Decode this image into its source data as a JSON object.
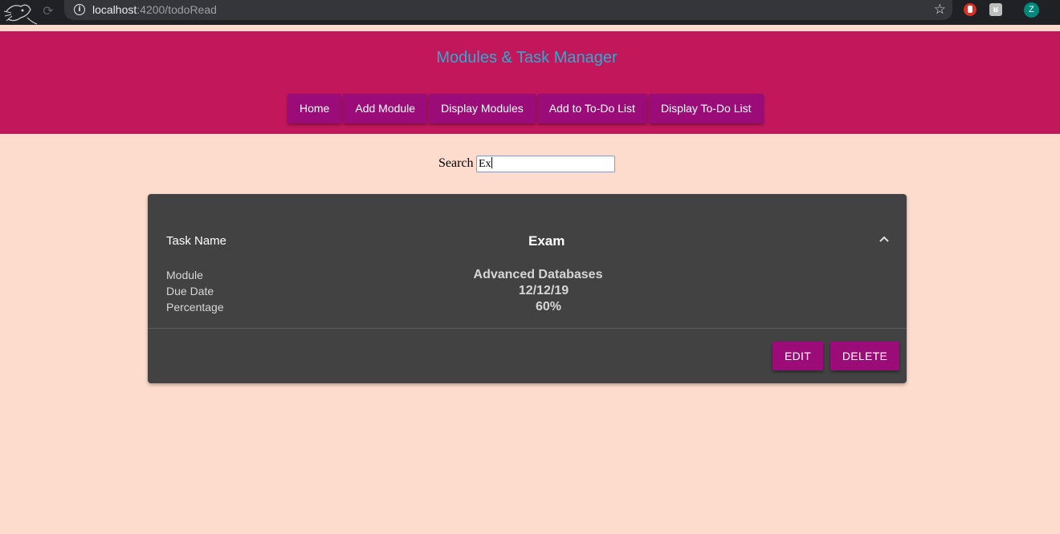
{
  "browser": {
    "url_host": "localhost",
    "url_path": ":4200/todoRead",
    "reload_icon": "reload-icon",
    "info_icon": "info-icon",
    "star_icon": "star-icon",
    "extension_2_label": "ʁ",
    "avatar_letter": "Z"
  },
  "header": {
    "title": "Modules & Task Manager",
    "nav": [
      {
        "label": "Home"
      },
      {
        "label": "Add Module"
      },
      {
        "label": "Display Modules"
      },
      {
        "label": "Add to To-Do List"
      },
      {
        "label": "Display To-Do List"
      }
    ]
  },
  "search": {
    "label": "Search",
    "value": "Ex"
  },
  "task_card": {
    "name_label": "Task Name",
    "name_value": "Exam",
    "expand_icon": "chevron-up-icon",
    "rows": [
      {
        "label": "Module",
        "value": "Advanced Databases"
      },
      {
        "label": "Due Date",
        "value": "12/12/19"
      },
      {
        "label": "Percentage",
        "value": "60%"
      }
    ],
    "edit_label": "EDIT",
    "delete_label": "DELETE"
  },
  "colors": {
    "page_bg": "#fedccd",
    "header_bg": "#c2185b",
    "title": "#2eaad0",
    "button": "#9c0c78",
    "card_bg": "#424242"
  }
}
